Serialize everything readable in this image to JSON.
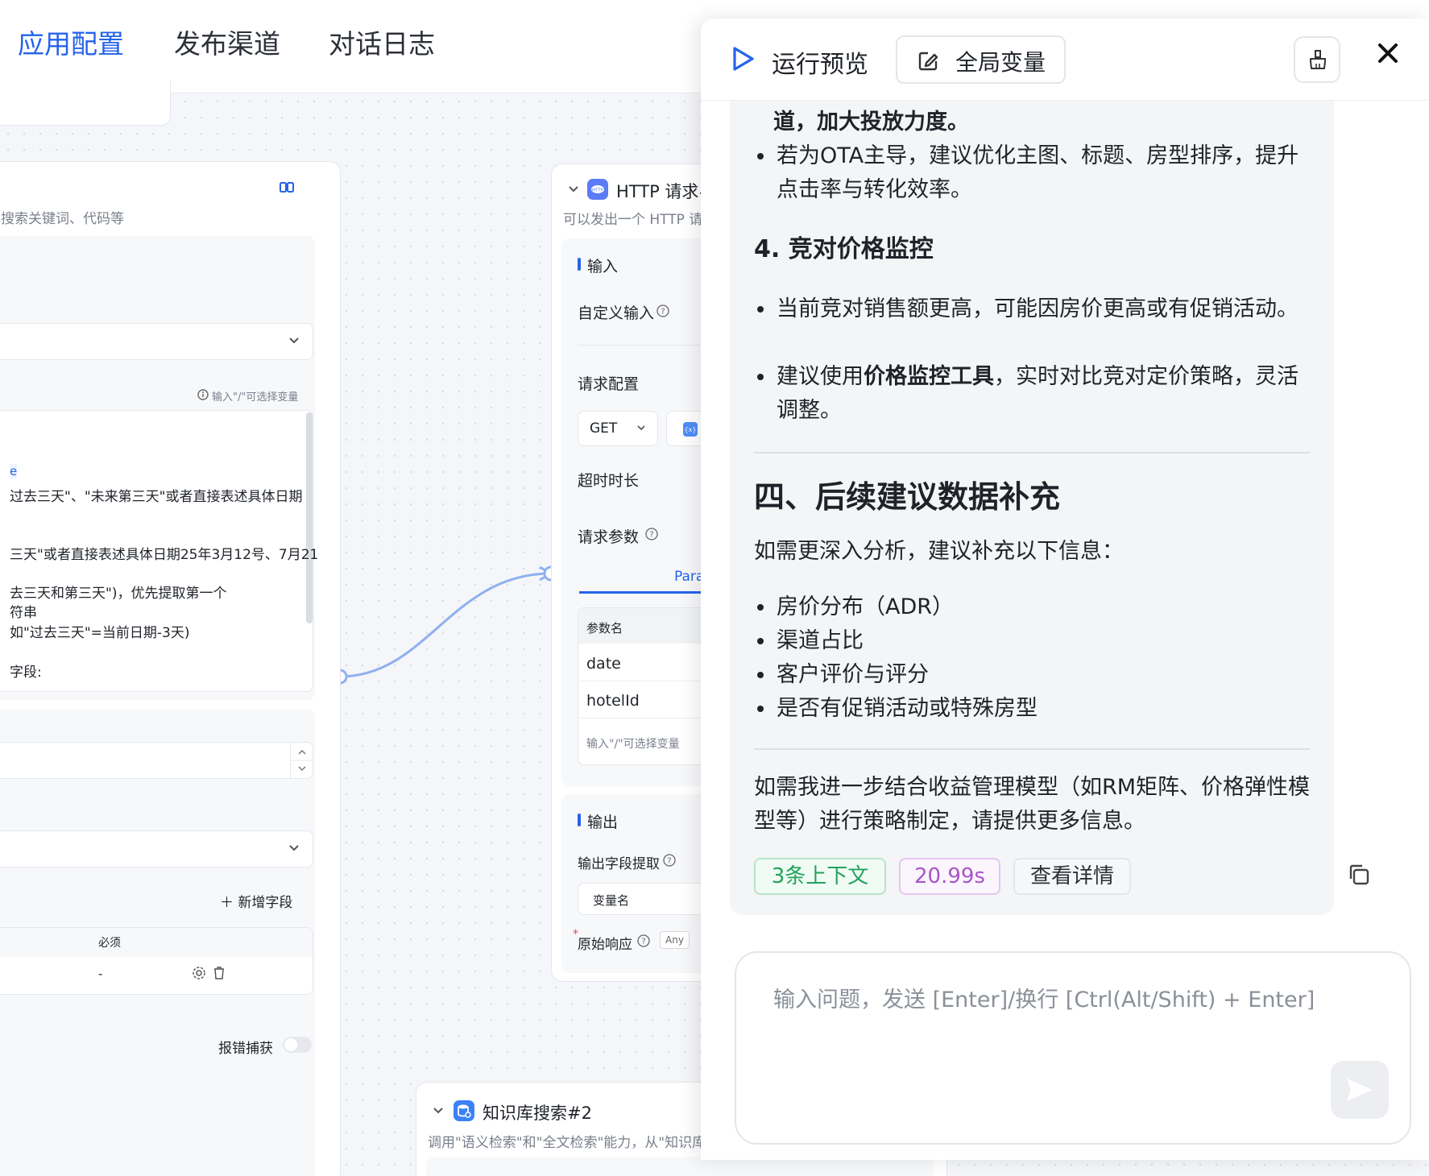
{
  "topbar": {
    "tabs": [
      "应用配置",
      "发布渠道",
      "对话日志"
    ]
  },
  "left_node": {
    "desc": "搜索关键词、代码等",
    "hint": "输入\"/\"可选择变量",
    "prompt_lines": [
      "e",
      "过去三天\"、\"未来第三天\"或者直接表述具体日期",
      "三天\"或者直接表述具体日期25年3月12号、7月21",
      "去三天和第三天\")，优先提取第一个",
      "符串",
      "如\"过去三天\"=当前日期-3天)",
      "字段:"
    ],
    "add_field": "新增字段",
    "table_header_required": "必须",
    "table_row_value": "-",
    "error_catch": "报错捕获"
  },
  "http_node": {
    "title": "HTTP 请求#",
    "desc": "可以发出一个 HTTP 请求",
    "input_section": "输入",
    "custom_input": "自定义输入",
    "request_config": "请求配置",
    "method": "GET",
    "timeout": "超时时长",
    "request_params": "请求参数",
    "params_tab": "Para",
    "param_header": "参数名",
    "params": [
      "date",
      "hotelId"
    ],
    "param_placeholder": "输入\"/\"可选择变量",
    "output_section": "输出",
    "output_extract": "输出字段提取",
    "var_name": "变量名",
    "raw_response": "原始响应",
    "any_badge": "Any"
  },
  "kb_node": {
    "title": "知识库搜索#2",
    "desc": "调用\"语义检索\"和\"全文检索\"能力，从\"知识库\"中"
  },
  "panel": {
    "title": "运行预览",
    "global_vars": "全局变量",
    "message": {
      "top_partial": "道，加大投放力度。",
      "bullet_ota": "若为OTA主导，建议优化主图、标题、房型排序，提升点击率与转化效率。",
      "h_price": "4. 竞对价格监控",
      "bullet_sales": "当前竞对销售额更高，可能因房价更高或有促销活动。",
      "bullet_tool_pre": "建议使用",
      "bullet_tool_bold": "价格监控工具",
      "bullet_tool_post": "，实时对比竞对定价策略，灵活调整。",
      "h_followup": "四、后续建议数据补充",
      "intro": "如需更深入分析，建议补充以下信息：",
      "items": [
        "房价分布（ADR）",
        "渠道占比",
        "客户评价与评分",
        "是否有促销活动或特殊房型"
      ],
      "closing": "如需我进一步结合收益管理模型（如RM矩阵、价格弹性模型等）进行策略制定，请提供更多信息。",
      "badges": {
        "context": "3条上下文",
        "time": "20.99s",
        "details": "查看详情"
      }
    },
    "input_placeholder": "输入问题，发送 [Enter]/换行 [Ctrl(Alt/Shift) + Enter]"
  },
  "colors": {
    "accent": "#2563eb",
    "green": "#22a35a",
    "purple": "#a855c7",
    "edge": "#8fb0f0"
  }
}
